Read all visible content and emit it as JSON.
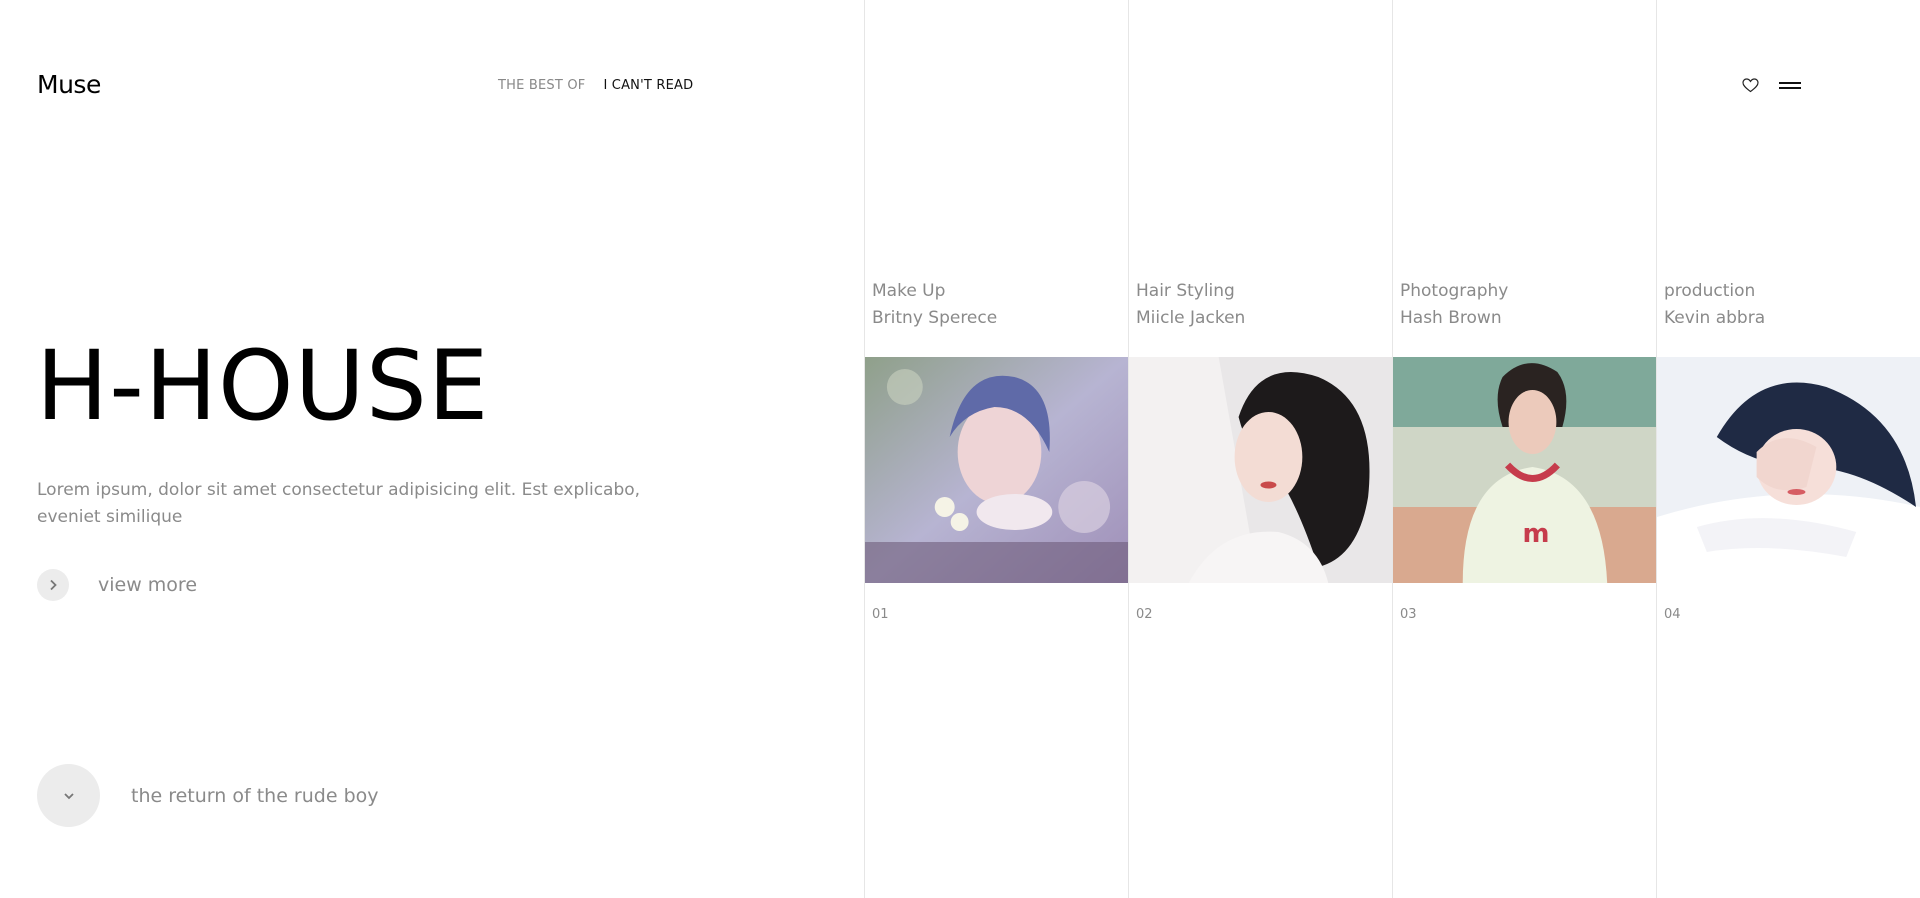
{
  "header": {
    "logo": "Muse",
    "nav": [
      {
        "label": "THE BEST OF"
      },
      {
        "label": "I CAN'T READ"
      }
    ]
  },
  "hero": {
    "title": "H-HOUSE",
    "description": "Lorem ipsum, dolor sit amet consectetur adipisicing elit. Est explicabo, eveniet similique",
    "view_more": "view more",
    "scroll_label": "the return of the rude boy"
  },
  "credits": [
    {
      "role": "Make Up",
      "name": "Britny Sperece",
      "number": "01"
    },
    {
      "role": "Hair Styling",
      "name": "Miicle Jacken",
      "number": "02"
    },
    {
      "role": "Photography",
      "name": "Hash Brown",
      "number": "03"
    },
    {
      "role": "production",
      "name": "Kevin abbra",
      "number": "04"
    }
  ],
  "icons": {
    "favorite": "heart-icon",
    "menu": "menu-icon",
    "view_more": "chevron-right-icon",
    "scroll": "chevron-down-icon"
  },
  "colors": {
    "text_muted": "#8a8a8a",
    "circle_bg": "#ececec",
    "divider": "#e6e6e6"
  }
}
